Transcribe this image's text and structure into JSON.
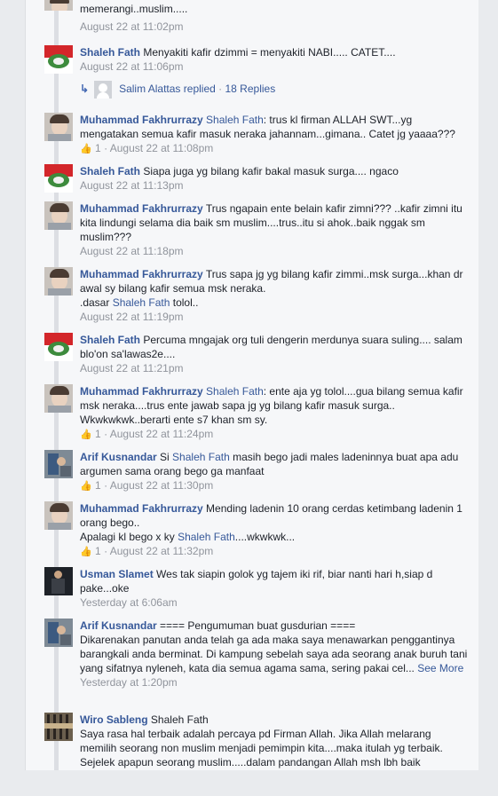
{
  "top_partial": {
    "text": "memerangi..muslim.....",
    "time": "August 22 at 11:02pm"
  },
  "comments": [
    {
      "author": "Shaleh Fath",
      "text": "Menyakiti kafir dzimmi = menyakiti NABI..... CATET....",
      "time": "August 22 at 11:06pm"
    },
    {
      "author": "Muhammad Fakhrurrazy",
      "mention": "Shaleh Fath",
      "text": ": trus kl firman ALLAH SWT...yg mengatakan semua kafir masuk neraka jahannam...gimana.. Catet jg yaaaa???",
      "likes": "1",
      "time": "August 22 at 11:08pm"
    },
    {
      "author": "Shaleh Fath",
      "text": "Siapa juga yg bilang kafir bakal masuk surga.... ngaco",
      "time": "August 22 at 11:13pm"
    },
    {
      "author": "Muhammad Fakhrurrazy",
      "text": "Trus ngapain ente belain kafir zimni??? ..kafir zimni itu kita lindungi selama dia baik sm muslim....trus..itu si ahok..baik nggak sm muslim???",
      "time": "August 22 at 11:18pm"
    },
    {
      "author": "Muhammad Fakhrurrazy",
      "text": "Trus sapa jg yg bilang kafir zimmi..msk surga...khan dr awal sy bilang kafir semua msk neraka.",
      "line2_pre": ".dasar ",
      "line2_mention": "Shaleh Fath",
      "line2_post": " tolol..",
      "time": "August 22 at 11:19pm"
    },
    {
      "author": "Shaleh Fath",
      "text": "Percuma mngajak org tuli dengerin merdunya suara suling.... salam blo'on sa'lawas2e....",
      "time": "August 22 at 11:21pm"
    },
    {
      "author": "Muhammad Fakhrurrazy",
      "mention": "Shaleh Fath",
      "text": ": ente aja yg tolol....gua bilang semua kafir msk neraka....trus ente jawab sapa jg yg bilang kafir masuk surga.. Wkwkwkwk..berarti ente s7 khan sm sy.",
      "likes": "1",
      "time": "August 22 at 11:24pm"
    },
    {
      "author": "Arif Kusnandar",
      "text": "Si",
      "mention": "Shaleh Fath",
      "text2": "masih bego jadi males ladeninnya buat apa adu argumen sama orang bego ga manfaat",
      "likes": "1",
      "time": "August 22 at 11:30pm"
    },
    {
      "author": "Muhammad Fakhrurrazy",
      "text": "Mending ladenin 10 orang cerdas ketimbang ladenin 1 orang bego..",
      "line2_pre": "Apalagi kl bego x ky ",
      "line2_mention": "Shaleh Fath",
      "line2_post": "....wkwkwk...",
      "likes": "1",
      "time": "August 22 at 11:32pm"
    },
    {
      "author": "Usman Slamet",
      "text": "Wes tak siapin golok yg tajem iki rif, biar nanti hari h,siap d pake...oke",
      "time": "Yesterday at 6:06am"
    },
    {
      "author": "Arif Kusnandar",
      "text": "==== Pengumuman buat gusdurian ====",
      "para": "Dikarenakan panutan anda telah ga ada maka saya menawarkan penggantinya barangkali anda berminat. Di kampung sebelah saya ada seorang anak buruh tani yang sifatnya nyleneh, kata dia semua agama sama, sering pakai cel...",
      "see_more": "See More",
      "time": "Yesterday at 1:20pm"
    },
    {
      "author": "Wiro Sableng",
      "text": "Shaleh Fath",
      "para": "Saya rasa hal terbaik adalah percaya pd Firman Allah. Jika Allah melarang memilih seorang non muslim menjadi pemimpin kita....maka itulah yg terbaik. Sejelek apapun seorang muslim.....dalam pandangan Allah msh lbh baik"
    }
  ],
  "reply_summary": {
    "name": "Salim Alattas",
    "replied": "replied",
    "sep": "·",
    "count": "18 Replies"
  }
}
